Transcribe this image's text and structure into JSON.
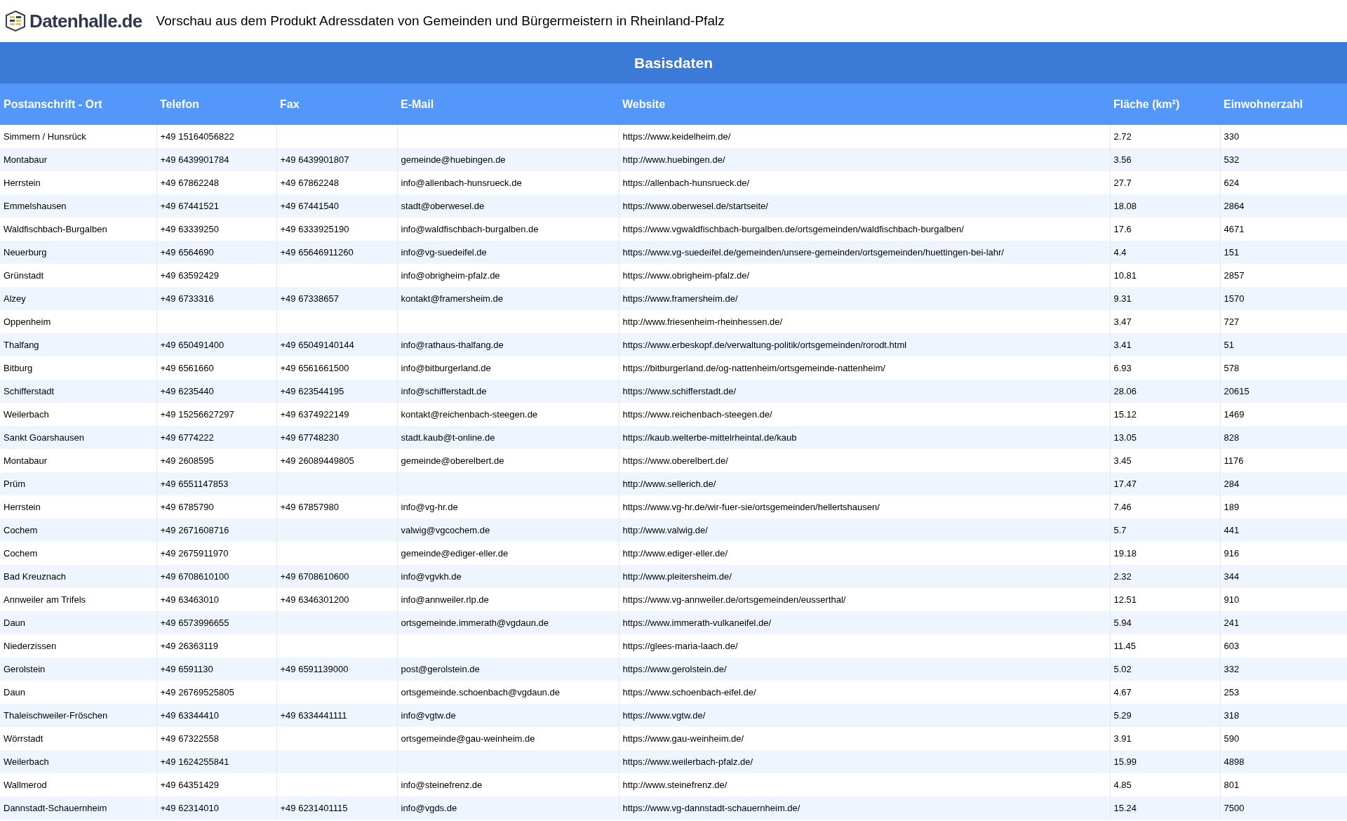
{
  "header": {
    "logo_text": "Datenhalle.de",
    "title": "Vorschau aus dem Produkt Adressdaten von Gemeinden und Bürgermeistern in Rheinland-Pfalz"
  },
  "table": {
    "group_heading": "Basisdaten",
    "columns": [
      "Postanschrift - Ort",
      "Telefon",
      "Fax",
      "E-Mail",
      "Website",
      "Fläche (km²)",
      "Einwohnerzahl"
    ],
    "rows": [
      [
        "Simmern / Hunsrück",
        "+49 15164056822",
        null,
        null,
        "https://www.keidelheim.de/",
        "2.72",
        "330"
      ],
      [
        "Montabaur",
        "+49 6439901784",
        "+49 6439901807",
        "gemeinde@huebingen.de",
        "http://www.huebingen.de/",
        "3.56",
        "532"
      ],
      [
        "Herrstein",
        "+49 67862248",
        "+49 67862248",
        "info@allenbach-hunsrueck.de",
        "https://allenbach-hunsrueck.de/",
        "27.7",
        "624"
      ],
      [
        "Emmelshausen",
        "+49 67441521",
        "+49 67441540",
        "stadt@oberwesel.de",
        "https://www.oberwesel.de/startseite/",
        "18.08",
        "2864"
      ],
      [
        "Waldfischbach-Burgalben",
        "+49 63339250",
        "+49 6333925190",
        "info@waldfischbach-burgalben.de",
        "https://www.vgwaldfischbach-burgalben.de/ortsgemeinden/waldfischbach-burgalben/",
        "17.6",
        "4671"
      ],
      [
        "Neuerburg",
        "+49 6564690",
        "+49 65646911260",
        "info@vg-suedeifel.de",
        "https://www.vg-suedeifel.de/gemeinden/unsere-gemeinden/ortsgemeinden/huettingen-bei-lahr/",
        "4.4",
        "151"
      ],
      [
        "Grünstadt",
        "+49 63592429",
        null,
        "info@obrigheim-pfalz.de",
        "https://www.obrigheim-pfalz.de/",
        "10.81",
        "2857"
      ],
      [
        "Alzey",
        "+49 6733316",
        "+49 67338657",
        "kontakt@framersheim.de",
        "https://www.framersheim.de/",
        "9.31",
        "1570"
      ],
      [
        "Oppenheim",
        null,
        null,
        null,
        "http://www.friesenheim-rheinhessen.de/",
        "3.47",
        "727"
      ],
      [
        "Thalfang",
        "+49 650491400",
        "+49 65049140144",
        "info@rathaus-thalfang.de",
        "https://www.erbeskopf.de/verwaltung-politik/ortsgemeinden/rorodt.html",
        "3.41",
        "51"
      ],
      [
        "Bitburg",
        "+49 6561660",
        "+49 6561661500",
        "info@bitburgerland.de",
        "https://bitburgerland.de/og-nattenheim/ortsgemeinde-nattenheim/",
        "6.93",
        "578"
      ],
      [
        "Schifferstadt",
        "+49 6235440",
        "+49 623544195",
        "info@schifferstadt.de",
        "https://www.schifferstadt.de/",
        "28.06",
        "20615"
      ],
      [
        "Weilerbach",
        "+49 15256627297",
        "+49 6374922149",
        "kontakt@reichenbach-steegen.de",
        "https://www.reichenbach-steegen.de/",
        "15.12",
        "1469"
      ],
      [
        "Sankt Goarshausen",
        "+49 6774222",
        "+49 67748230",
        "stadt.kaub@t-online.de",
        "https://kaub.welterbe-mittelrheintal.de/kaub",
        "13.05",
        "828"
      ],
      [
        "Montabaur",
        "+49 2608595",
        "+49 26089449805",
        "gemeinde@oberelbert.de",
        "https://www.oberelbert.de/",
        "3.45",
        "1176"
      ],
      [
        "Prüm",
        "+49 6551147853",
        null,
        null,
        "http://www.sellerich.de/",
        "17.47",
        "284"
      ],
      [
        "Herrstein",
        "+49 6785790",
        "+49 67857980",
        "info@vg-hr.de",
        "https://www.vg-hr.de/wir-fuer-sie/ortsgemeinden/hellertshausen/",
        "7.46",
        "189"
      ],
      [
        "Cochem",
        "+49 2671608716",
        null,
        "valwig@vgcochem.de",
        "http://www.valwig.de/",
        "5.7",
        "441"
      ],
      [
        "Cochem",
        "+49 2675911970",
        null,
        "gemeinde@ediger-eller.de",
        "http://www.ediger-eller.de/",
        "19.18",
        "916"
      ],
      [
        "Bad Kreuznach",
        "+49 6708610100",
        "+49 6708610600",
        "info@vgvkh.de",
        "http://www.pleitersheim.de/",
        "2.32",
        "344"
      ],
      [
        "Annweiler am Trifels",
        "+49 63463010",
        "+49 6346301200",
        "info@annweiler.rlp.de",
        "https://www.vg-annweiler.de/ortsgemeinden/eusserthal/",
        "12.51",
        "910"
      ],
      [
        "Daun",
        "+49 6573996655",
        null,
        "ortsgemeinde.immerath@vgdaun.de",
        "https://www.immerath-vulkaneifel.de/",
        "5.94",
        "241"
      ],
      [
        "Niederzissen",
        "+49 26363119",
        null,
        null,
        "https://glees-maria-laach.de/",
        "11.45",
        "603"
      ],
      [
        "Gerolstein",
        "+49 6591130",
        "+49 6591139000",
        "post@gerolstein.de",
        "https://www.gerolstein.de/",
        "5.02",
        "332"
      ],
      [
        "Daun",
        "+49 26769525805",
        null,
        "ortsgemeinde.schoenbach@vgdaun.de",
        "https://www.schoenbach-eifel.de/",
        "4.67",
        "253"
      ],
      [
        "Thaleischweiler-Fröschen",
        "+49 63344410",
        "+49 6334441111",
        "info@vgtw.de",
        "https://www.vgtw.de/",
        "5.29",
        "318"
      ],
      [
        "Wörrstadt",
        "+49 67322558",
        null,
        "ortsgemeinde@gau-weinheim.de",
        "https://www.gau-weinheim.de/",
        "3.91",
        "590"
      ],
      [
        "Weilerbach",
        "+49 1624255841",
        null,
        null,
        "https://www.weilerbach-pfalz.de/",
        "15.99",
        "4898"
      ],
      [
        "Wallmerod",
        "+49 64351429",
        null,
        "info@steinefrenz.de",
        "http://www.steinefrenz.de/",
        "4.85",
        "801"
      ],
      [
        "Dannstadt-Schauernheim",
        "+49 62314010",
        "+49 6231401115",
        "info@vgds.de",
        "https://www.vg-dannstadt-schauernheim.de/",
        "15.24",
        "7500"
      ]
    ]
  }
}
